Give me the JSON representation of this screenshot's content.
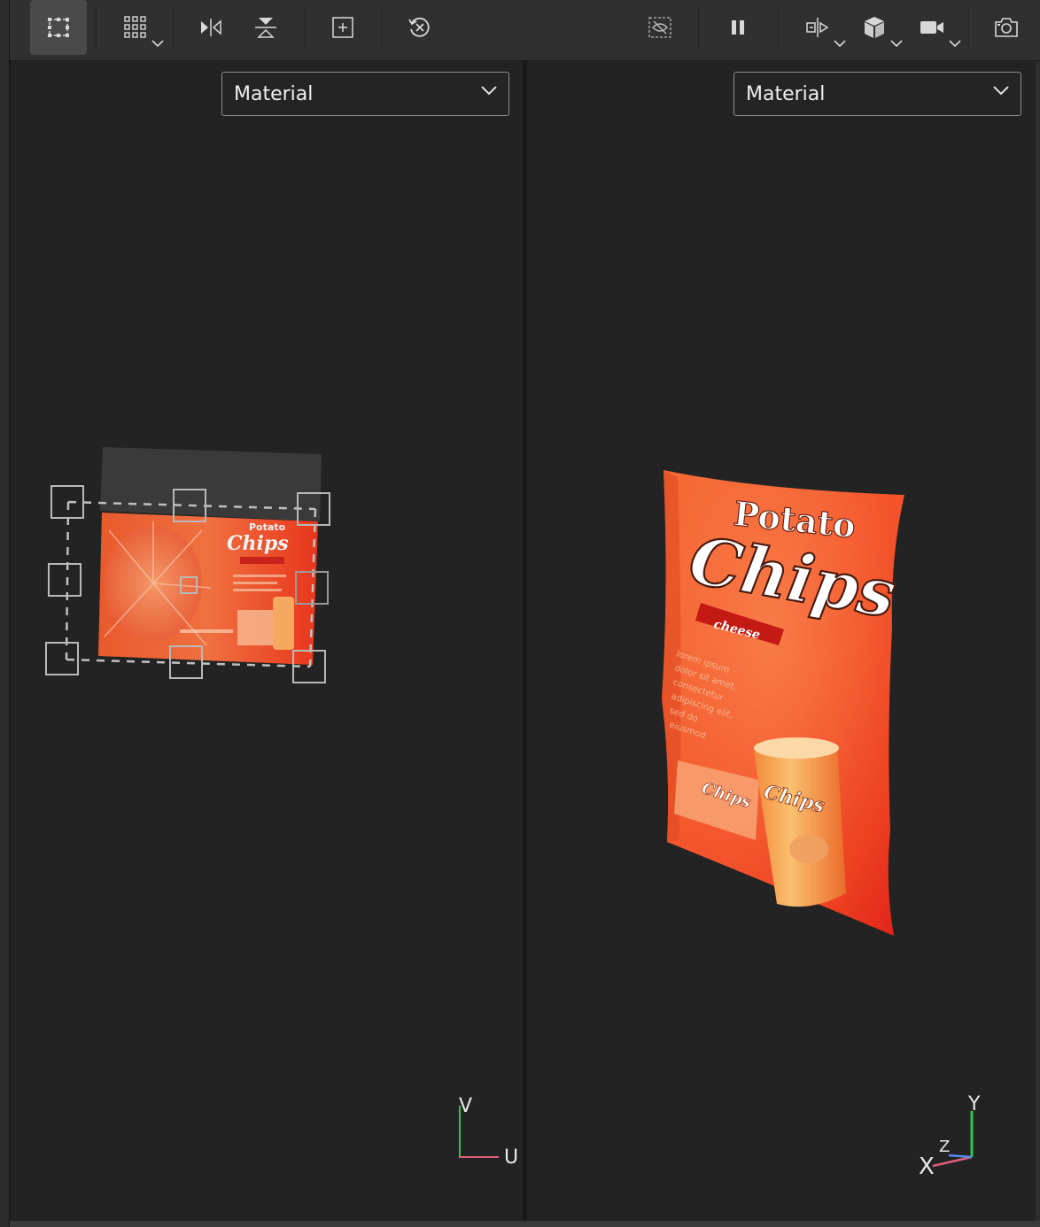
{
  "toolbar": {
    "left_tools": [
      {
        "id": "select-box",
        "active": true
      },
      {
        "id": "grid-snap",
        "has_dropdown": true
      },
      {
        "id": "mirror-horizontal"
      },
      {
        "id": "mirror-vertical"
      },
      {
        "id": "center-pivot"
      },
      {
        "id": "reset-transform"
      }
    ],
    "right_tools": [
      {
        "id": "hide-selection"
      },
      {
        "id": "pause"
      },
      {
        "id": "symmetry",
        "has_dropdown": true
      },
      {
        "id": "display-mode",
        "has_dropdown": true
      },
      {
        "id": "camera",
        "has_dropdown": true
      },
      {
        "id": "screenshot"
      }
    ]
  },
  "left_viewport": {
    "shading_mode": "Material",
    "axis": {
      "vertical": "V",
      "horizontal": "U"
    }
  },
  "right_viewport": {
    "shading_mode": "Material",
    "axis": {
      "x": "X",
      "y": "Y",
      "z": "Z"
    }
  },
  "product": {
    "title_line1": "Potato",
    "title_line2": "Chips",
    "flavor": "cheese",
    "desc_lines": [
      "lorem ipsum",
      "dolor sit amet,",
      "consectetur",
      "adipiscing elit,",
      "sed do",
      "eiusmod"
    ],
    "can_label": "Chips"
  },
  "colors": {
    "bag_orange": "#f0602a",
    "bag_red": "#e8381e",
    "accent_yellow": "#f5b04a"
  }
}
